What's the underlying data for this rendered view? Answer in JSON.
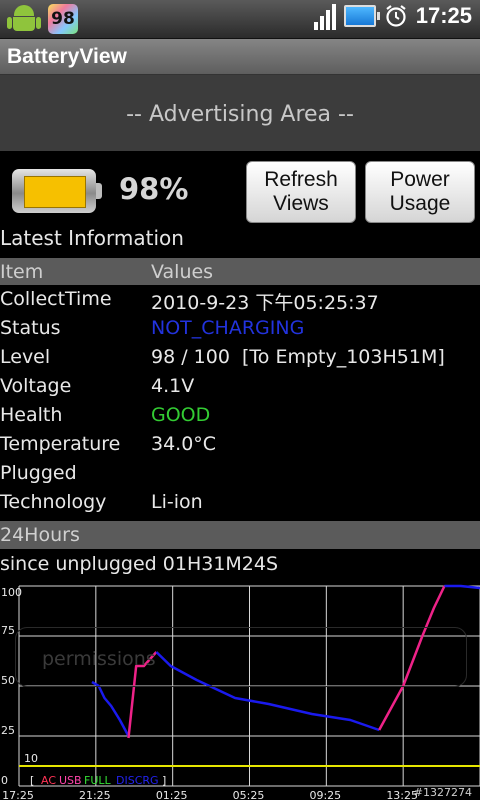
{
  "status_bar": {
    "notification_badge": "98",
    "time": "17:25",
    "icons": [
      "android-icon",
      "signal-icon",
      "battery-icon",
      "alarm-icon"
    ]
  },
  "app_title": "BatteryView",
  "ad_area": "-- Advertising Area --",
  "battery": {
    "percent_text": "98%",
    "level": 98
  },
  "buttons": {
    "refresh": "Refresh\nViews",
    "power": "Power\nUsage"
  },
  "latest_label": "Latest Information",
  "table": {
    "headers": [
      "Item",
      "Values"
    ],
    "rows": [
      {
        "key": "CollectTime",
        "value": "2010-9-23 下午05:25:37",
        "color": "#e8e8e8"
      },
      {
        "key": "Status",
        "value": "NOT_CHARGING",
        "color": "#2233dd"
      },
      {
        "key": "Level",
        "value": "98 / 100  [To Empty_103H51M]",
        "color": "#e8e8e8"
      },
      {
        "key": "Voltage",
        "value": "4.1V",
        "color": "#e8e8e8"
      },
      {
        "key": "Health",
        "value": "GOOD",
        "color": "#33cc33"
      },
      {
        "key": "Temperature",
        "value": "34.0°C",
        "color": "#e8e8e8"
      },
      {
        "key": "Plugged",
        "value": "",
        "color": "#e8e8e8"
      },
      {
        "key": "Technology",
        "value": "Li-ion",
        "color": "#e8e8e8"
      }
    ]
  },
  "hours_label": "24Hours",
  "since_label": "since unplugged 01H31M24S",
  "overlay_text": "permissions",
  "chart_data": {
    "type": "line",
    "x_ticks": [
      "17:25",
      "21:25",
      "01:25",
      "05:25",
      "09:25",
      "13:25"
    ],
    "y_ticks": [
      0,
      25,
      50,
      75,
      100
    ],
    "ylim": [
      0,
      100
    ],
    "xlim_hours": [
      0,
      24
    ],
    "threshold": 10,
    "threshold_label": "10",
    "legend": [
      {
        "label": "[",
        "color": "#e8e8e8"
      },
      {
        "label": "AC",
        "color": "#ff3355"
      },
      {
        "label": "USB",
        "color": "#ff44aa"
      },
      {
        "label": "FULL",
        "color": "#33dd33"
      },
      {
        "label": "DISCRG",
        "color": "#2222ee"
      },
      {
        "label": "]",
        "color": "#e8e8e8"
      }
    ],
    "watermark": "#1327274",
    "series": [
      {
        "color": "#1a1aee",
        "points": [
          [
            7.6,
            52
          ],
          [
            8.3,
            50
          ],
          [
            8.9,
            44
          ],
          [
            9.6,
            40
          ],
          [
            10.5,
            33
          ],
          [
            11.4,
            25
          ]
        ]
      },
      {
        "color": "#ee2288",
        "points": [
          [
            11.4,
            24
          ],
          [
            12.2,
            60
          ],
          [
            13.0,
            60
          ],
          [
            14.3,
            67
          ]
        ]
      },
      {
        "color": "#1a1aee",
        "points": [
          [
            14.3,
            67
          ],
          [
            15.8,
            60
          ],
          [
            18.5,
            53
          ],
          [
            22.5,
            44
          ],
          [
            26.0,
            41
          ],
          [
            30.5,
            36
          ],
          [
            34.5,
            33
          ],
          [
            37.5,
            28
          ]
        ]
      },
      {
        "color": "#ee2288",
        "points": [
          [
            37.5,
            28
          ],
          [
            40.0,
            50
          ],
          [
            42.0,
            75
          ],
          [
            43.2,
            89
          ],
          [
            44.3,
            100
          ]
        ]
      },
      {
        "color": "#1a1aee",
        "points": [
          [
            44.3,
            100
          ],
          [
            46.0,
            100
          ],
          [
            48.0,
            99
          ]
        ]
      }
    ]
  }
}
